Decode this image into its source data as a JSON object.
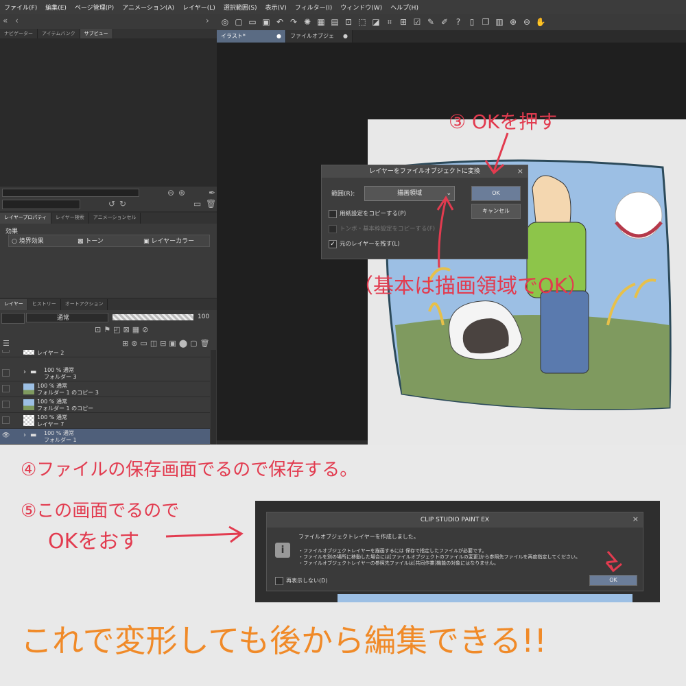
{
  "menu": [
    "ファイル(F)",
    "編集(E)",
    "ページ管理(P)",
    "アニメーション(A)",
    "レイヤー(L)",
    "選択範囲(S)",
    "表示(V)",
    "フィルター(I)",
    "ウィンドウ(W)",
    "ヘルプ(H)"
  ],
  "document_tabs": [
    {
      "label": "イラスト*",
      "close": "●"
    },
    {
      "label": "ファイルオブジェクト",
      "close": "●"
    }
  ],
  "nav_tabs": [
    "ナビゲーター",
    "アイテムバンク",
    "サブビュー"
  ],
  "property_tabs": [
    "レイヤープロパティ",
    "レイヤー検索",
    "アニメーションセル"
  ],
  "property_panel": {
    "section": "効果",
    "items": [
      "境界効果",
      "トーン",
      "レイヤーカラー"
    ]
  },
  "layer_tabs": [
    "レイヤー",
    "ヒストリー",
    "オートアクション"
  ],
  "layer_controls": {
    "blend_mode": "通常",
    "opacity": "100"
  },
  "layers": [
    {
      "mode": "",
      "name": "レイヤー 2",
      "type": "raster",
      "selected": false
    },
    {
      "mode": "100 % 通常",
      "name": "フォルダー 3",
      "type": "folder",
      "selected": false
    },
    {
      "mode": "100 % 通常",
      "name": "フォルダー 1 のコピー 3",
      "type": "image",
      "selected": false
    },
    {
      "mode": "100 % 通常",
      "name": "フォルダー 1 のコピー",
      "type": "image",
      "selected": false
    },
    {
      "mode": "100 % 通常",
      "name": "レイヤー 7",
      "type": "raster",
      "selected": false
    },
    {
      "mode": "100 % 通常",
      "name": "フォルダー 1",
      "type": "folder",
      "selected": true
    }
  ],
  "dialog1": {
    "title": "レイヤーをファイルオブジェクトに変換",
    "range_label": "範囲(R):",
    "range_value": "描画領域",
    "ok": "OK",
    "cancel": "キャンセル",
    "options": [
      {
        "label": "用紙設定をコピーする(P)",
        "checked": false,
        "disabled": false
      },
      {
        "label": "トンボ・基本枠設定をコピーする(F)",
        "checked": false,
        "disabled": true
      },
      {
        "label": "元のレイヤーを残す(L)",
        "checked": true,
        "disabled": false
      }
    ]
  },
  "dialog2": {
    "title": "CLIP STUDIO PAINT EX",
    "message": "ファイルオブジェクトレイヤーを作成しました。",
    "details": [
      "・ファイルオブジェクトレイヤーを描画するには 保存で指定したファイルが必要です。",
      "・ファイルを別の場所に移動した場合には[ファイルオブジェクトのファイルの変更]から参照先ファイルを再度指定してください。",
      "・ファイルオブジェクトレイヤーの参照先ファイルは[共同作業]機能の対象にはなりません。"
    ],
    "dont_show": "再表示しない(D)",
    "ok": "OK"
  },
  "annotations": {
    "step3": "③ OKを押す",
    "note": "（基本は描画領域でOK）",
    "step4": "④ファイルの保存画面でるので保存する。",
    "step5_line1": "⑤この画面でるので",
    "step5_line2": "OKをおす",
    "conclusion": "これで変形しても後から編集できる!!"
  },
  "colors": {
    "annotation_red": "#e23b4f",
    "annotation_orange": "#f08a28",
    "accent_blue": "#6b7d99"
  }
}
